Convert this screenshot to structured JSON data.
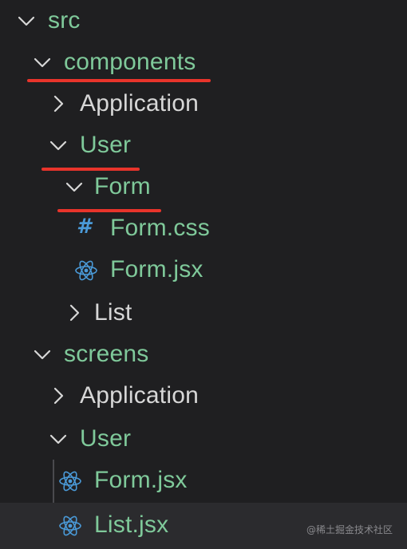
{
  "tree": {
    "src": "src",
    "components": "components",
    "comp_application": "Application",
    "comp_user": "User",
    "form_folder": "Form",
    "form_css": "Form.css",
    "form_jsx": "Form.jsx",
    "list_folder": "List",
    "screens": "screens",
    "screens_application": "Application",
    "screens_user": "User",
    "screens_form_jsx": "Form.jsx",
    "screens_list_jsx": "List.jsx"
  },
  "icons": {
    "css_icon": "#",
    "react_icon": "react-icon"
  },
  "watermark": "@稀土掘金技术社区",
  "colors": {
    "folder_text": "#7fc99a",
    "plain_text": "#d7d7d7",
    "underline": "#e8342b",
    "css_hash": "#4a9ad8",
    "react": "#4a9ad8"
  }
}
